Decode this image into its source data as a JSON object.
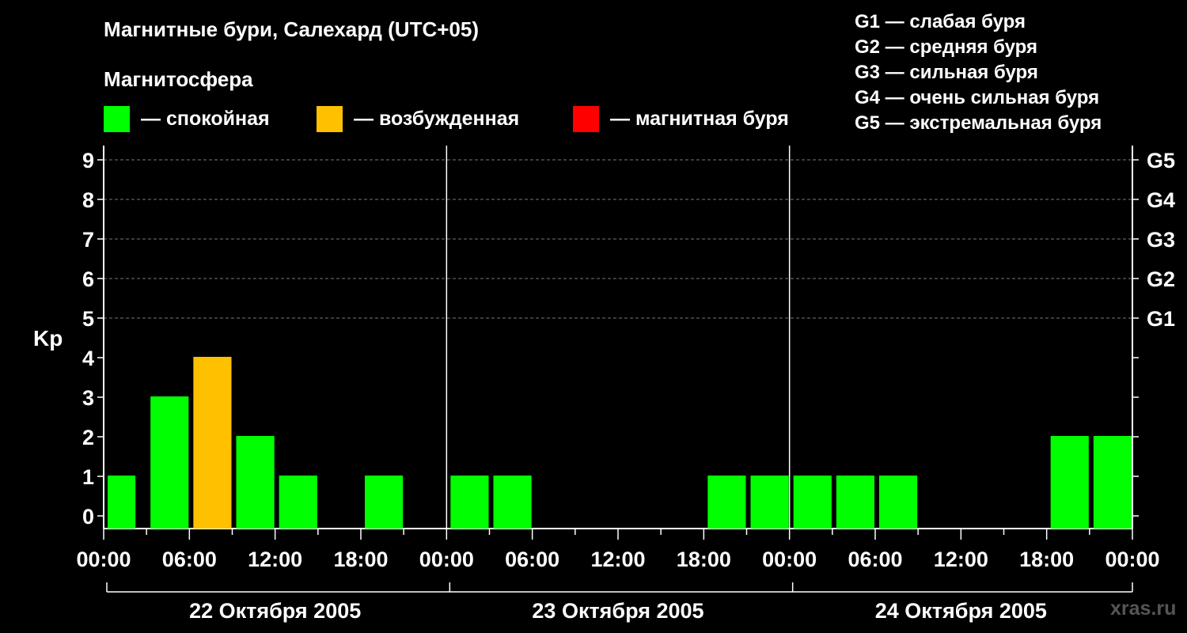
{
  "header": {
    "title": "Магнитные бури, Салехард (UTC+05)",
    "subtitle": "Магнитосфера"
  },
  "legend": [
    {
      "label": "— спокойная",
      "color": "#00ff00"
    },
    {
      "label": "— возбужденная",
      "color": "#ffc000"
    },
    {
      "label": "— магнитная буря",
      "color": "#ff0000"
    }
  ],
  "g_levels": [
    "G1 — слабая буря",
    "G2 — средняя буря",
    "G3 — сильная буря",
    "G4 — очень сильная буря",
    "G5 — экстремальная буря"
  ],
  "watermark": "xras.ru",
  "chart_data": {
    "type": "bar",
    "ylabel": "Kp",
    "ylim": [
      0,
      9
    ],
    "yticks": [
      "0",
      "1",
      "2",
      "3",
      "4",
      "5",
      "6",
      "7",
      "8",
      "9"
    ],
    "right_ticks": [
      {
        "kp": 5,
        "label": "G1"
      },
      {
        "kp": 6,
        "label": "G2"
      },
      {
        "kp": 7,
        "label": "G3"
      },
      {
        "kp": 8,
        "label": "G4"
      },
      {
        "kp": 9,
        "label": "G5"
      }
    ],
    "grid": "dashed horizontal at Kp 5-9",
    "days": [
      "22 Октября 2005",
      "23 Октября 2005",
      "24 Октября 2005"
    ],
    "xtick_labels": [
      "00:00",
      "06:00",
      "12:00",
      "18:00",
      "00:00",
      "06:00",
      "12:00",
      "18:00",
      "00:00",
      "06:00",
      "12:00",
      "18:00",
      "00:00"
    ],
    "interval_hours": 3,
    "series": [
      {
        "values": [
          1,
          3,
          4,
          2,
          1,
          0,
          1,
          0,
          1,
          1,
          0,
          0,
          0,
          0,
          1,
          1,
          1,
          1,
          1,
          0,
          0,
          0,
          2,
          2
        ],
        "last_partial": 2
      }
    ],
    "colors": {
      "quiet": "#00ff00",
      "active": "#ffc000",
      "storm": "#ff0000"
    }
  }
}
